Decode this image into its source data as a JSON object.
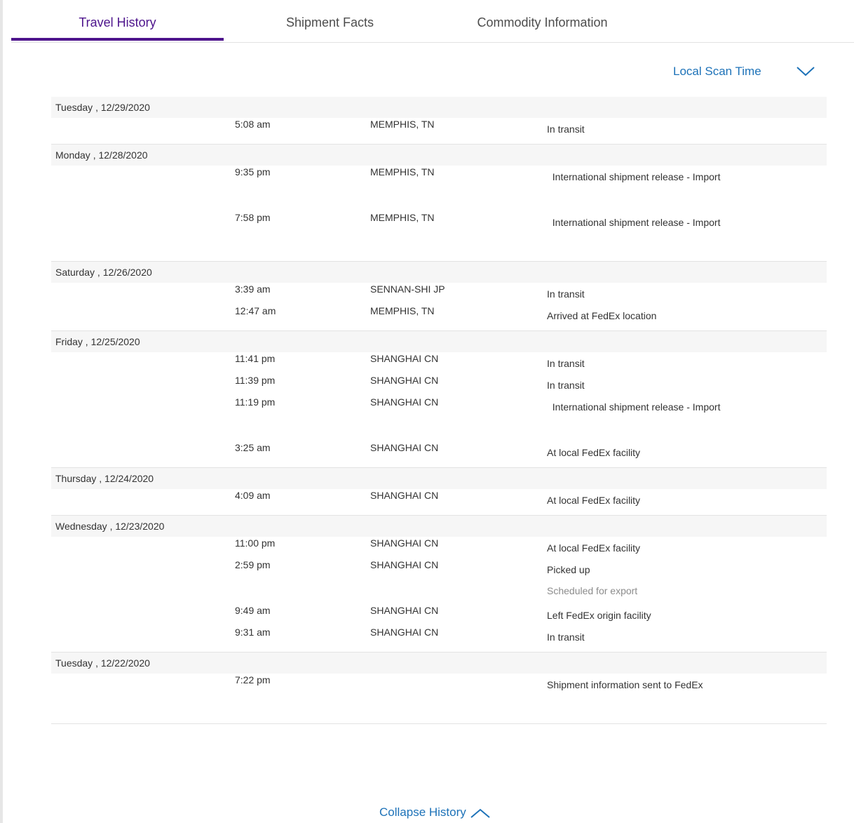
{
  "tabs": [
    "Travel History",
    "Shipment Facts",
    "Commodity Information"
  ],
  "scan_time_label": "Local Scan Time",
  "collapse_label": "Collapse History",
  "colors": {
    "accent_purple": "#4d148c",
    "link_blue": "#1d72b8"
  },
  "days": [
    {
      "date": "Tuesday , 12/29/2020",
      "scans": [
        {
          "time": "5:08 am",
          "location": "MEMPHIS, TN",
          "status": "In transit"
        }
      ]
    },
    {
      "date": "Monday , 12/28/2020",
      "scans": [
        {
          "time": "9:35 pm",
          "location": "MEMPHIS, TN",
          "status": "  International shipment release - Import"
        },
        {
          "time": "7:58 pm",
          "location": "MEMPHIS, TN",
          "status": "  International shipment release - Import"
        }
      ]
    },
    {
      "date": "Saturday , 12/26/2020",
      "scans": [
        {
          "time": "3:39 am",
          "location": "SENNAN-SHI JP",
          "status": "In transit"
        },
        {
          "time": "12:47 am",
          "location": "MEMPHIS, TN",
          "status": "Arrived at FedEx location"
        }
      ]
    },
    {
      "date": "Friday , 12/25/2020",
      "scans": [
        {
          "time": "11:41 pm",
          "location": "SHANGHAI CN",
          "status": "In transit"
        },
        {
          "time": "11:39 pm",
          "location": "SHANGHAI CN",
          "status": "In transit"
        },
        {
          "time": "11:19 pm",
          "location": "SHANGHAI CN",
          "status": "  International shipment release - Import"
        },
        {
          "time": "3:25 am",
          "location": "SHANGHAI CN",
          "status": "At local FedEx facility"
        }
      ]
    },
    {
      "date": "Thursday , 12/24/2020",
      "scans": [
        {
          "time": "4:09 am",
          "location": "SHANGHAI CN",
          "status": "At local FedEx facility"
        }
      ]
    },
    {
      "date": "Wednesday , 12/23/2020",
      "scans": [
        {
          "time": "11:00 pm",
          "location": "SHANGHAI CN",
          "status": "At local FedEx facility"
        },
        {
          "time": "2:59 pm",
          "location": "SHANGHAI CN",
          "status": "Picked up",
          "substatus": "Scheduled for export"
        },
        {
          "time": "9:49 am",
          "location": "SHANGHAI CN",
          "status": "Left FedEx origin facility"
        },
        {
          "time": "9:31 am",
          "location": "SHANGHAI CN",
          "status": "In transit"
        }
      ]
    },
    {
      "date": "Tuesday , 12/22/2020",
      "scans": [
        {
          "time": "7:22 pm",
          "location": "",
          "status": "Shipment information sent to FedEx"
        }
      ]
    }
  ]
}
